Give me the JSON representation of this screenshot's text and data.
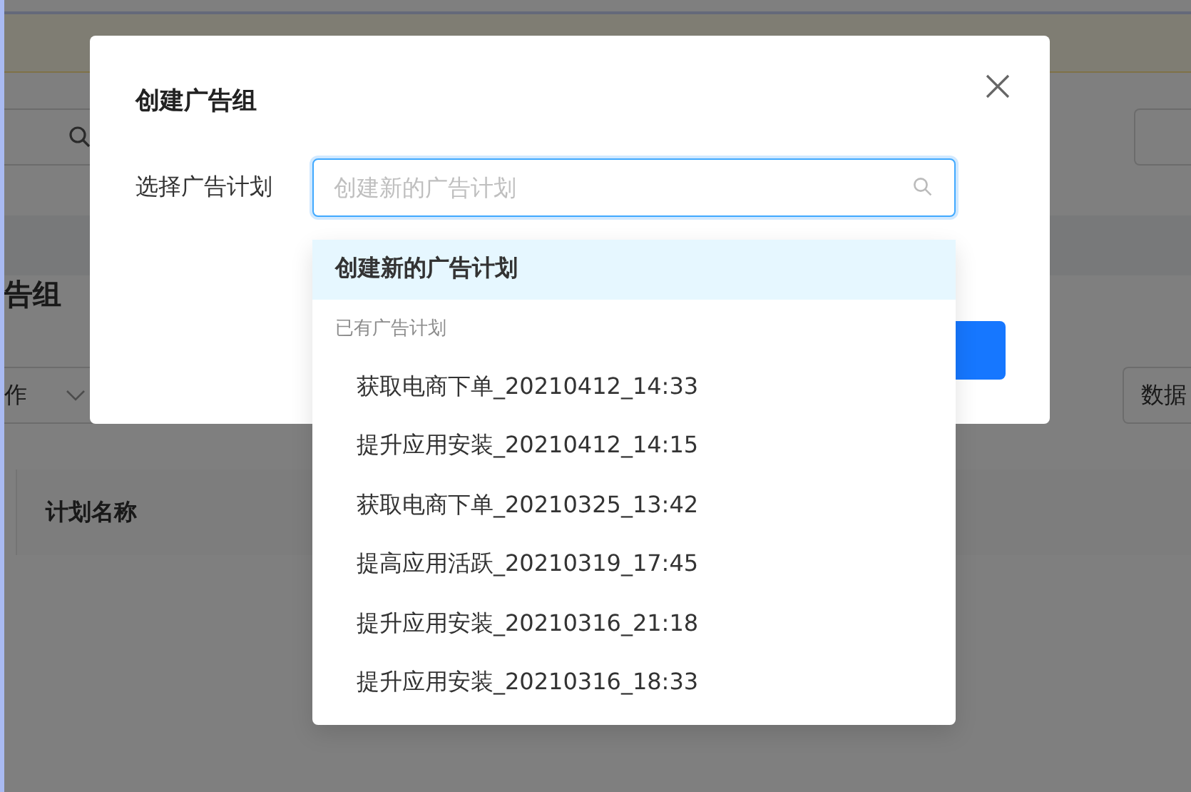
{
  "background_page": {
    "page_title": "告组",
    "filter_select": {
      "value": "作"
    },
    "data_button": "数据",
    "table": {
      "columns": [
        "计划名称"
      ]
    }
  },
  "dialog": {
    "title": "创建广告组",
    "field_label": "选择广告计划",
    "plan_select": {
      "placeholder": "创建新的广告计划"
    },
    "dropdown": {
      "create_option": {
        "label": "创建新的广告计划",
        "selected": true
      },
      "group_label": "已有广告计划",
      "options": [
        {
          "label": "获取电商下单_20210412_14:33",
          "selected": false
        },
        {
          "label": "提升应用安装_20210412_14:15",
          "selected": false
        },
        {
          "label": "获取电商下单_20210325_13:42",
          "selected": false
        },
        {
          "label": "提高应用活跃_20210319_17:45",
          "selected": false
        },
        {
          "label": "提升应用安装_20210316_21:18",
          "selected": false
        },
        {
          "label": "提升应用安装_20210316_18:33",
          "selected": false
        }
      ]
    }
  }
}
